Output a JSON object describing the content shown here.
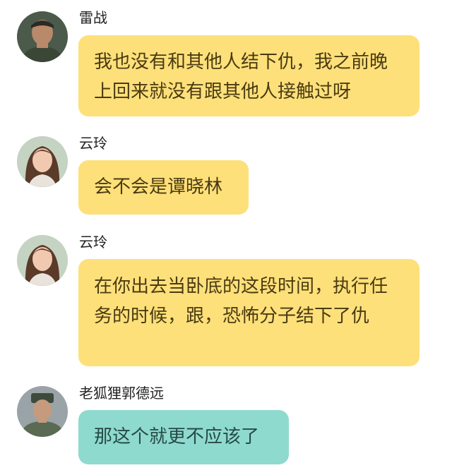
{
  "colors": {
    "yellow_bubble": "#fee07a",
    "teal_bubble": "#8fdacf"
  },
  "messages": [
    {
      "sender": "雷战",
      "avatar_icon": "male-soldier-avatar",
      "text": "我也没有和其他人结下仇，我之前晚上回来就没有跟其他人接触过呀",
      "bubble_color": "yellow"
    },
    {
      "sender": "云玲",
      "avatar_icon": "female-avatar",
      "text": "会不会是谭晓林",
      "bubble_color": "yellow"
    },
    {
      "sender": "云玲",
      "avatar_icon": "female-avatar",
      "text": "在你出去当卧底的这段时间，执行任务的时候，跟，恐怖分子结下了仇",
      "bubble_color": "yellow"
    },
    {
      "sender": "老狐狸郭德远",
      "avatar_icon": "male-officer-avatar",
      "text": "那这个就更不应该了",
      "bubble_color": "teal"
    }
  ]
}
